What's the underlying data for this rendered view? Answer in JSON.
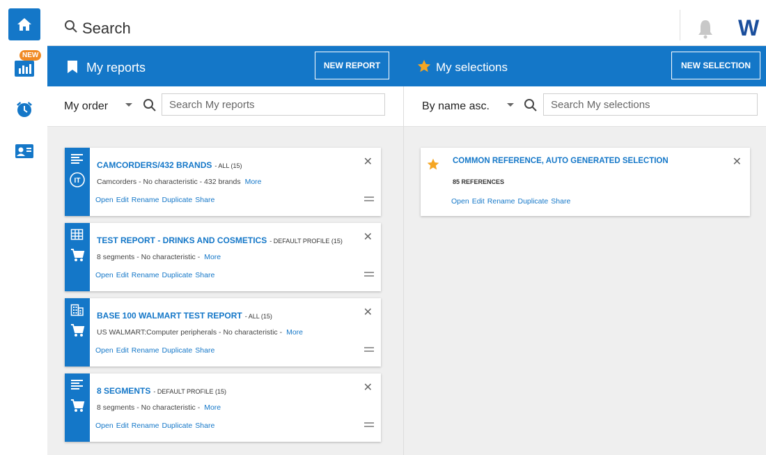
{
  "nav": {
    "new_badge": "NEW"
  },
  "topbar": {
    "search_text": "Search",
    "logo_left": "W",
    "logo_right": ""
  },
  "reports": {
    "title": "My reports",
    "new_button": "NEW REPORT",
    "sort": "My order",
    "search_placeholder": "Search My reports",
    "items": [
      {
        "title": "CAMCORDERS/432 BRANDS",
        "profile": "- ALL (15)",
        "desc": "Camcorders - No characteristic - 432 brands",
        "more": "More"
      },
      {
        "title": "TEST REPORT - DRINKS AND COSMETICS",
        "profile": "- DEFAULT PROFILE (15)",
        "desc": "8 segments - No characteristic -",
        "more": "More"
      },
      {
        "title": "BASE 100 WALMART TEST REPORT",
        "profile": "- ALL (15)",
        "desc": "US WALMART:Computer peripherals - No characteristic -",
        "more": "More"
      },
      {
        "title": "8 SEGMENTS",
        "profile": "- DEFAULT PROFILE (15)",
        "desc": "8 segments - No characteristic -",
        "more": "More"
      }
    ]
  },
  "selections": {
    "title": "My selections",
    "new_button": "NEW SELECTION",
    "sort": "By name asc.",
    "search_placeholder": "Search My selections",
    "items": [
      {
        "title": "COMMON REFERENCE, AUTO GENERATED SELECTION",
        "count": "85 REFERENCES"
      }
    ]
  },
  "actions": {
    "open": "Open",
    "edit": "Edit",
    "rename": "Rename",
    "duplicate": "Duplicate",
    "share": "Share"
  },
  "glyphs": {
    "close": "✕"
  },
  "colors": {
    "primary": "#1477c8",
    "accent": "#f08a23",
    "background": "#efefef"
  }
}
